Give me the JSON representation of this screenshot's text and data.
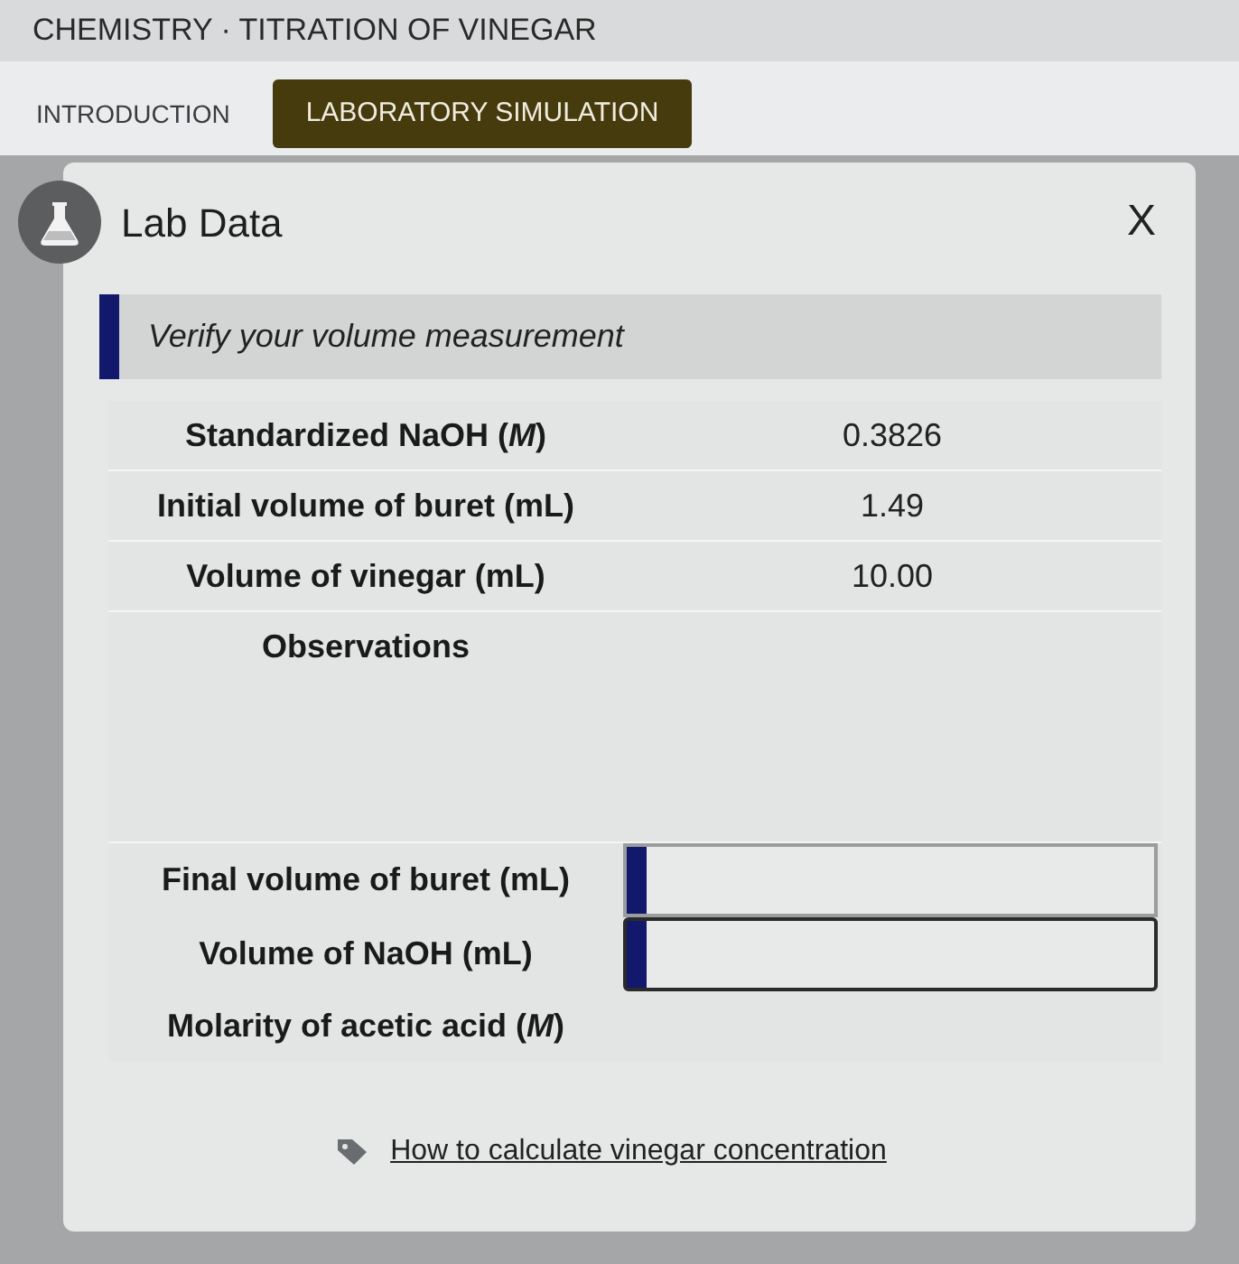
{
  "header": {
    "breadcrumb": "CHEMISTRY · TITRATION OF VINEGAR"
  },
  "tabs": [
    {
      "label": "INTRODUCTION",
      "selected": false
    },
    {
      "label": "LABORATORY SIMULATION",
      "selected": true
    }
  ],
  "panel": {
    "title": "Lab Data",
    "close": "X",
    "instruction": "Verify your volume measurement",
    "rows": [
      {
        "kind": "value",
        "label": "Standardized NaOH (*M*)",
        "value": "0.3826"
      },
      {
        "kind": "value",
        "label": "Initial volume of buret (mL)",
        "value": "1.49"
      },
      {
        "kind": "value",
        "label": "Volume of vinegar (mL)",
        "value": "10.00"
      },
      {
        "kind": "notes",
        "label": "Observations"
      },
      {
        "kind": "input",
        "label": "Final volume of buret (mL)"
      },
      {
        "kind": "input",
        "label": "Volume of NaOH (mL)"
      },
      {
        "kind": "result",
        "label": "Molarity of acetic acid (*M*)"
      }
    ],
    "link": "How to calculate vinegar concentration"
  }
}
